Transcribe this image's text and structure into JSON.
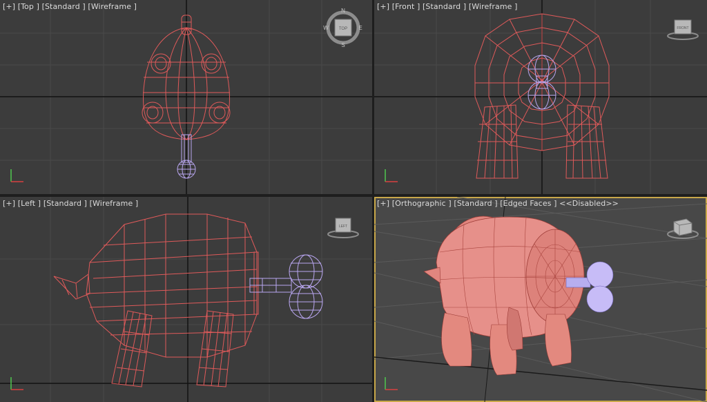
{
  "viewports": [
    {
      "id": "top",
      "menu": "[+]",
      "view": "[Top ]",
      "shading": "[Standard ]",
      "mode": "[Wireframe ]",
      "extra": ""
    },
    {
      "id": "front",
      "menu": "[+]",
      "view": "[Front ]",
      "shading": "[Standard ]",
      "mode": "[Wireframe ]",
      "extra": ""
    },
    {
      "id": "left",
      "menu": "[+]",
      "view": "[Left ]",
      "shading": "[Standard ]",
      "mode": "[Wireframe ]",
      "extra": ""
    },
    {
      "id": "persp",
      "menu": "[+]",
      "view": "[Orthographic ]",
      "shading": "[Standard ]",
      "mode": "[Edged Faces ]",
      "extra": "<<Disabled>>"
    }
  ],
  "viewcube": {
    "top_face": "TOP",
    "front_face": "FRONT",
    "left_face": "LEFT",
    "compass": {
      "n": "N",
      "s": "S",
      "e": "E",
      "w": "W"
    }
  },
  "colors": {
    "viewport_bg": "#3c3c3c",
    "grid_line": "#4a4a4a",
    "axis_line": "#111111",
    "wire_red": "#e05a5a",
    "wire_lilac": "#b9a6f0",
    "shaded_body": "#e6908a",
    "active_border": "#c9a84a"
  }
}
